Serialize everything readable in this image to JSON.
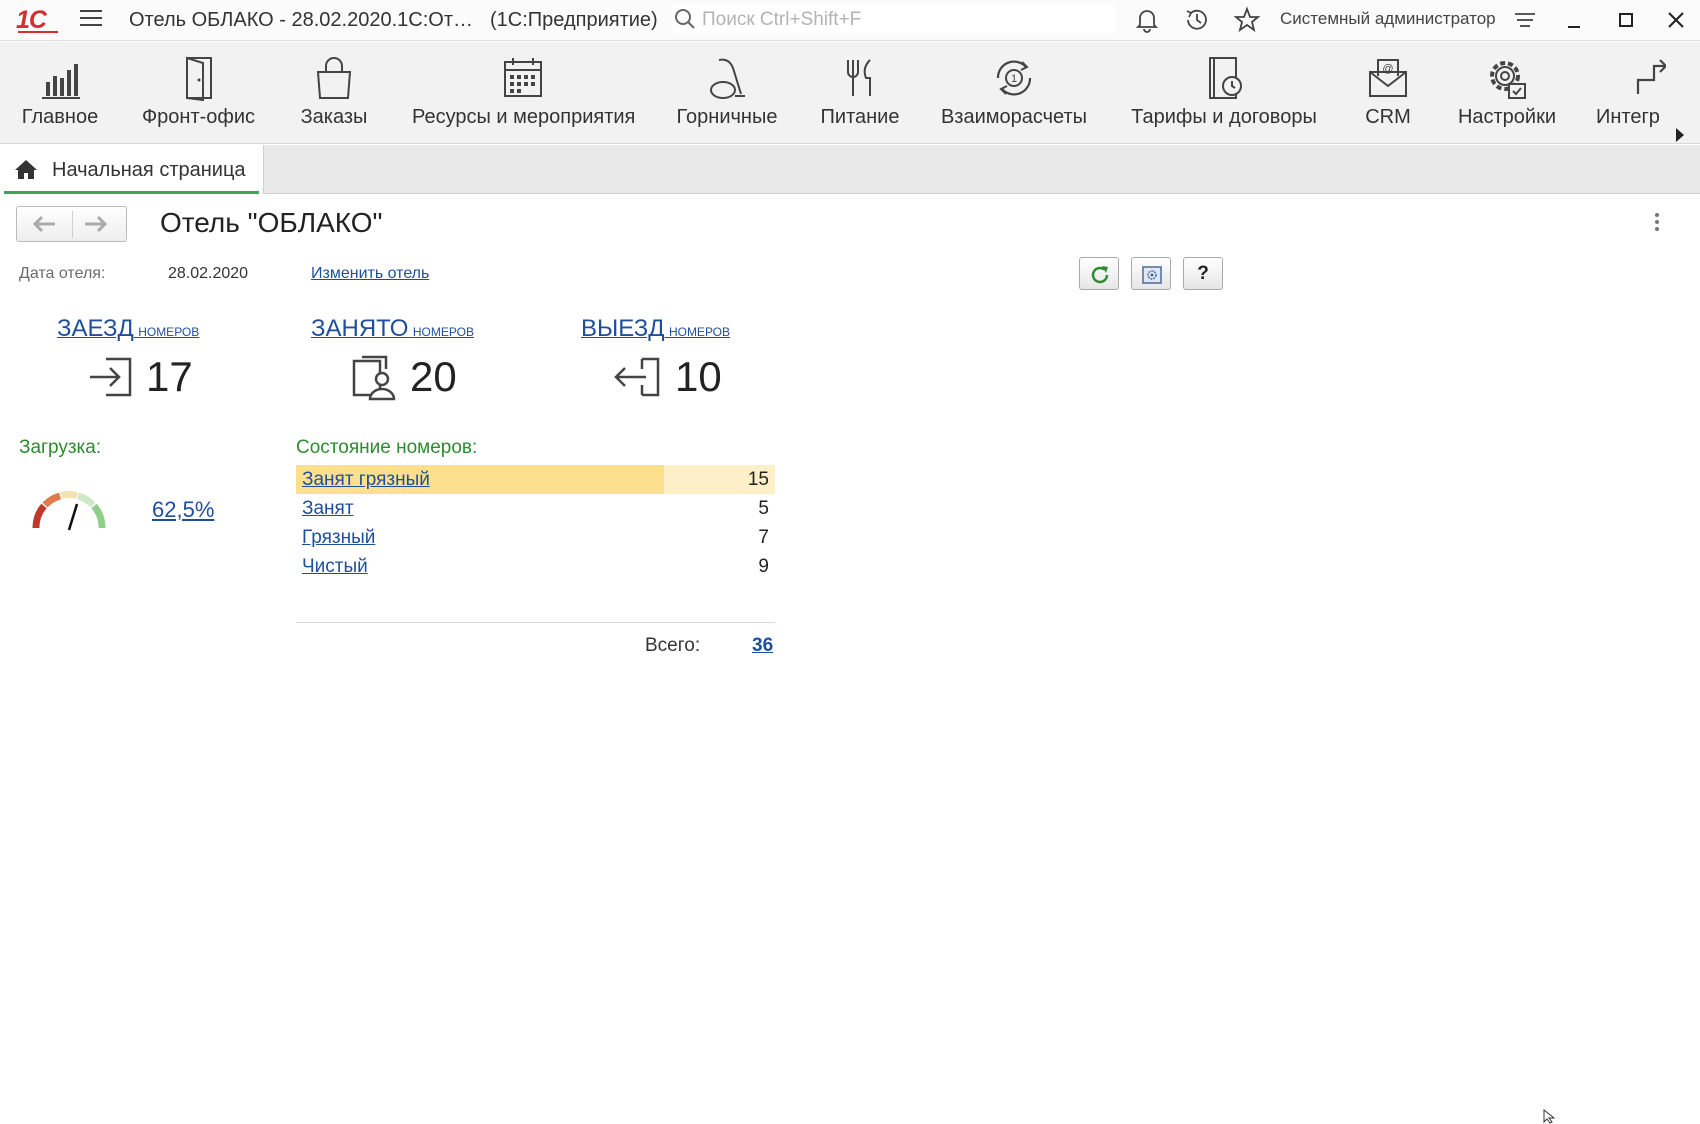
{
  "app": {
    "window_title": "Отель ОБЛАКО - 28.02.2020.1С:От…",
    "platform": "(1С:Предприятие)",
    "search_placeholder": "Поиск Ctrl+Shift+F",
    "user": "Системный администратор"
  },
  "sections": [
    {
      "label": "Главное",
      "icon": "bar-chart-icon"
    },
    {
      "label": "Фронт-офис",
      "icon": "door-icon"
    },
    {
      "label": "Заказы",
      "icon": "shopping-bag-icon"
    },
    {
      "label": "Ресурсы и мероприятия",
      "icon": "calendar-icon"
    },
    {
      "label": "Горничные",
      "icon": "vacuum-icon"
    },
    {
      "label": "Питание",
      "icon": "cutlery-icon"
    },
    {
      "label": "Взаиморасчеты",
      "icon": "settlement-icon"
    },
    {
      "label": "Тарифы и договоры",
      "icon": "contract-icon"
    },
    {
      "label": "CRM",
      "icon": "crm-mail-icon"
    },
    {
      "label": "Настройки",
      "icon": "gear-icon"
    },
    {
      "label": "Интегр",
      "icon": "integration-icon"
    }
  ],
  "tab": {
    "home_label": "Начальная страница"
  },
  "page": {
    "title": "Отель \"ОБЛАКО\"",
    "hotel_date_label": "Дата отеля:",
    "hotel_date_value": "28.02.2020",
    "change_hotel_link": "Изменить отель",
    "help_label": "?"
  },
  "stats": {
    "checkin": {
      "head": "ЗАЕЗД",
      "sub": "номеров",
      "value": "17"
    },
    "occupied": {
      "head": "ЗАНЯТО",
      "sub": "номеров",
      "value": "20"
    },
    "checkout": {
      "head": "ВЫЕЗД",
      "sub": "номеров",
      "value": "10"
    }
  },
  "load": {
    "label": "Загрузка:",
    "value": "62,5%",
    "fraction": 0.625
  },
  "room_state": {
    "label": "Состояние номеров:",
    "rows": [
      {
        "name": "Занят грязный",
        "count": "15",
        "highlight": true
      },
      {
        "name": "Занят",
        "count": "5"
      },
      {
        "name": "Грязный",
        "count": "7"
      },
      {
        "name": "Чистый",
        "count": "9"
      }
    ],
    "total_label": "Всего:",
    "total_value": "36"
  },
  "colors": {
    "link": "#1f4f9c",
    "green_label": "#2e8b2e",
    "highlight_bar": "#fde08e",
    "highlight_bar_light": "#fdf0c8",
    "tab_accent": "#3ba55c",
    "logo_red": "#d32f2f"
  }
}
